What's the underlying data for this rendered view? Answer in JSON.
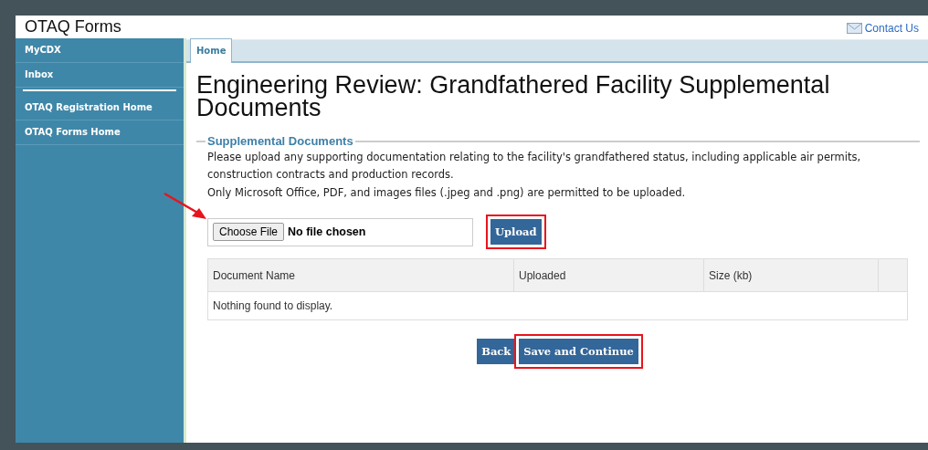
{
  "header": {
    "title": "OTAQ Forms",
    "contact_link": "Contact Us"
  },
  "sidebar": {
    "items": [
      {
        "label": "MyCDX",
        "separator_after": false
      },
      {
        "label": "Inbox",
        "separator_after": true
      },
      {
        "label": "OTAQ Registration Home",
        "separator_after": false
      },
      {
        "label": "OTAQ Forms Home",
        "separator_after": false
      }
    ]
  },
  "tabs": [
    {
      "label": "Home",
      "selected": true
    }
  ],
  "page_title": "Engineering Review: Grandfathered Facility Supplemental Documents",
  "section": {
    "legend": "Supplemental Documents",
    "instructions": [
      "Please upload any supporting documentation relating to the facility's grandfathered status, including applicable air permits, construction contracts and production records.",
      "Only Microsoft Office, PDF, and images files (.jpeg and .png) are permitted to be uploaded."
    ],
    "file_input": {
      "button": "Choose File",
      "value": "No file chosen",
      "annotated": true
    },
    "upload_button": {
      "label": "Upload",
      "highlighted": true
    },
    "table": {
      "columns": [
        "Document Name",
        "Uploaded",
        "Size (kb)",
        ""
      ],
      "empty_message": "Nothing found to display."
    }
  },
  "buttons": [
    {
      "label": "Back",
      "highlighted": false
    },
    {
      "label": "Save and Continue",
      "highlighted": true
    }
  ]
}
